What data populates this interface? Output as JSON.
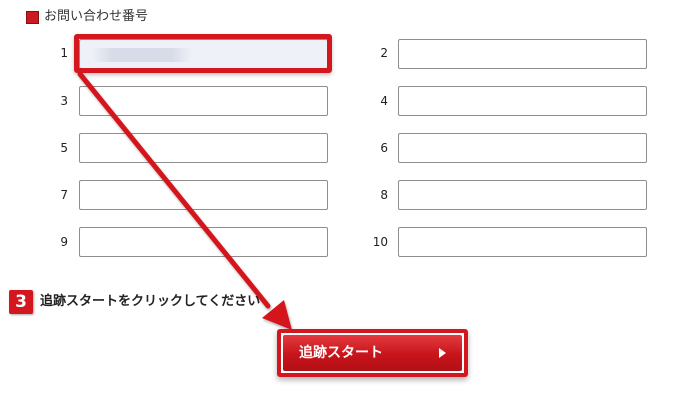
{
  "section": {
    "title": "お問い合わせ番号"
  },
  "fields": [
    {
      "number": "1",
      "value": "",
      "placeholder": ""
    },
    {
      "number": "2",
      "value": "",
      "placeholder": ""
    },
    {
      "number": "3",
      "value": "",
      "placeholder": ""
    },
    {
      "number": "4",
      "value": "",
      "placeholder": ""
    },
    {
      "number": "5",
      "value": "",
      "placeholder": ""
    },
    {
      "number": "6",
      "value": "",
      "placeholder": ""
    },
    {
      "number": "7",
      "value": "",
      "placeholder": ""
    },
    {
      "number": "8",
      "value": "",
      "placeholder": ""
    },
    {
      "number": "9",
      "value": "",
      "placeholder": ""
    },
    {
      "number": "10",
      "value": "",
      "placeholder": ""
    }
  ],
  "step": {
    "number": "3",
    "instruction": "追跡スタートをクリックしてください"
  },
  "start_button": {
    "label": "追跡スタート",
    "icon": "play-triangle-icon"
  },
  "colors": {
    "accent": "#d4161f",
    "field_border": "#8e8e8e",
    "highlight_fill": "#eef1f8"
  }
}
